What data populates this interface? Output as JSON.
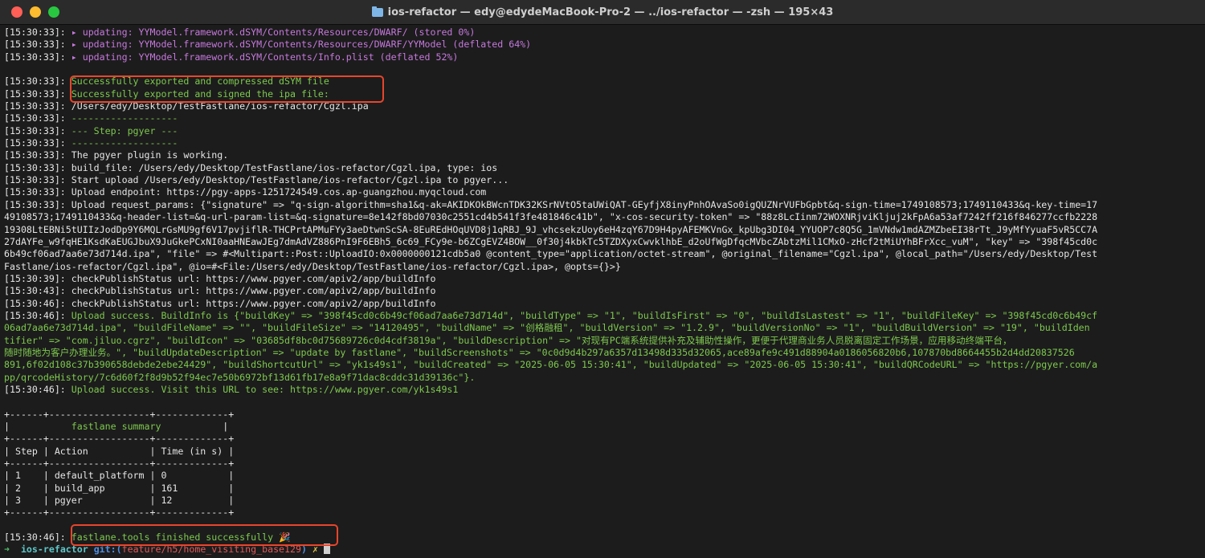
{
  "window": {
    "title": "ios-refactor — edy@edydeMacBook-Pro-2 — ../ios-refactor — -zsh — 195×43"
  },
  "lines": [
    {
      "p": "[15:30:33]: ",
      "c": "magenta",
      "t": "▸ updating: YYModel.framework.dSYM/Contents/Resources/DWARF/ (stored 0%)"
    },
    {
      "p": "[15:30:33]: ",
      "c": "magenta",
      "t": "▸ updating: YYModel.framework.dSYM/Contents/Resources/DWARF/YYModel (deflated 64%)"
    },
    {
      "p": "[15:30:33]: ",
      "c": "magenta",
      "t": "▸ updating: YYModel.framework.dSYM/Contents/Info.plist (deflated 52%)"
    },
    {
      "p": "",
      "c": "white",
      "t": ""
    },
    {
      "p": "[15:30:33]: ",
      "c": "green",
      "t": "Successfully exported and compressed dSYM file"
    },
    {
      "p": "[15:30:33]: ",
      "c": "green",
      "t": "Successfully exported and signed the ipa file:"
    },
    {
      "p": "[15:30:33]: ",
      "c": "white",
      "t": "/Users/edy/Desktop/TestFastlane/ios-refactor/Cgzl.ipa"
    },
    {
      "p": "[15:30:33]: ",
      "c": "green",
      "t": "-------------------"
    },
    {
      "p": "[15:30:33]: ",
      "c": "green",
      "t": "--- Step: pgyer ---"
    },
    {
      "p": "[15:30:33]: ",
      "c": "green",
      "t": "-------------------"
    },
    {
      "p": "[15:30:33]: ",
      "c": "white",
      "t": "The pgyer plugin is working."
    },
    {
      "p": "[15:30:33]: ",
      "c": "white",
      "t": "build_file: /Users/edy/Desktop/TestFastlane/ios-refactor/Cgzl.ipa, type: ios"
    },
    {
      "p": "[15:30:33]: ",
      "c": "white",
      "t": "Start upload /Users/edy/Desktop/TestFastlane/ios-refactor/Cgzl.ipa to pgyer..."
    },
    {
      "p": "[15:30:33]: ",
      "c": "white",
      "t": "Upload endpoint: https://pgy-apps-1251724549.cos.ap-guangzhou.myqcloud.com"
    },
    {
      "p": "[15:30:33]: ",
      "c": "white",
      "t": "Upload request_params: {\"signature\" => \"q-sign-algorithm=sha1&q-ak=AKIDKOkBWcnTDK32KSrNVtO5taUWiQAT-GEyfjX8inyPnhOAvaSo0igQUZNrVUFbGpbt&q-sign-time=1749108573;1749110433&q-key-time=17"
    },
    {
      "p": "",
      "c": "white",
      "t": "49108573;1749110433&q-header-list=&q-url-param-list=&q-signature=8e142f8bd07030c2551cd4b541f3fe481846c41b\", \"x-cos-security-token\" => \"88z8LcIinm72WOXNRjviKljuj2kFpA6a53af7242ff216f846277ccfb2228"
    },
    {
      "p": "",
      "c": "white",
      "t": "19308LtEBNi5tUIIzJodDp9Y6MQLrGsMU9gf6V17pvjiflR-THCPrtAPMuFYy3aeDtwnScSA-8EuREdHOqUVD8j1qRBJ_9J_vhcsekzUoy6eH4zqY67D9H4pyAFEMKVnGx_kpUbg3DI04_YYUOP7c8Q5G_1mVNdw1mdAZMZbeEI38rTt_J9yMfYyuaF5vR5CC7A"
    },
    {
      "p": "",
      "c": "white",
      "t": "27dAYFe_w9fqHE1KsdKaEUGJbuX9JuGkePCxNI0aaHNEawJEg7dmAdVZ886PnI9F6EBh5_6c69_FCy9e-b6ZCgEVZ4BOW__0f30j4kbkTc5TZDXyxCwvklhbE_d2oUfWgDfqcMVbcZAbtzMil1CMxO-zHcf2tMiUYhBFrXcc_vuM\", \"key\" => \"398f45cd0c"
    },
    {
      "p": "",
      "c": "white",
      "t": "6b49cf06ad7aa6e73d714d.ipa\", \"file\" => #<Multipart::Post::UploadIO:0x0000000121cdb5a0 @content_type=\"application/octet-stream\", @original_filename=\"Cgzl.ipa\", @local_path=\"/Users/edy/Desktop/Test"
    },
    {
      "p": "",
      "c": "white",
      "t": "Fastlane/ios-refactor/Cgzl.ipa\", @io=#<File:/Users/edy/Desktop/TestFastlane/ios-refactor/Cgzl.ipa>, @opts={}>}"
    },
    {
      "p": "[15:30:39]: ",
      "c": "white",
      "t": "checkPublishStatus url: https://www.pgyer.com/apiv2/app/buildInfo"
    },
    {
      "p": "[15:30:43]: ",
      "c": "white",
      "t": "checkPublishStatus url: https://www.pgyer.com/apiv2/app/buildInfo"
    },
    {
      "p": "[15:30:46]: ",
      "c": "white",
      "t": "checkPublishStatus url: https://www.pgyer.com/apiv2/app/buildInfo"
    },
    {
      "p": "[15:30:46]: ",
      "c": "green",
      "t": "Upload success. BuildInfo is {\"buildKey\" => \"398f45cd0c6b49cf06ad7aa6e73d714d\", \"buildType\" => \"1\", \"buildIsFirst\" => \"0\", \"buildIsLastest\" => \"1\", \"buildFileKey\" => \"398f45cd0c6b49cf"
    },
    {
      "p": "",
      "c": "green",
      "t": "06ad7aa6e73d714d.ipa\", \"buildFileName\" => \"\", \"buildFileSize\" => \"14120495\", \"buildName\" => \"创格融租\", \"buildVersion\" => \"1.2.9\", \"buildVersionNo\" => \"1\", \"buildBuildVersion\" => \"19\", \"buildIden"
    },
    {
      "p": "",
      "c": "green",
      "t": "tifier\" => \"com.jiluo.cgrz\", \"buildIcon\" => \"03685df8bc0d75689726c0d4cdf3819a\", \"buildDescription\" => \"对现有PC端系统提供补充及辅助性操作，更便于代理商业务人员脱离固定工作场景，应用移动终端平台，"
    },
    {
      "p": "",
      "c": "green",
      "t": "随时随地为客户办理业务。\", \"buildUpdateDescription\" => \"update by fastlane\", \"buildScreenshots\" => \"0c0d9d4b297a6357d13498d335d32065,ace89afe9c491d88904a0186056820b6,107870bd8664455b2d4dd20837526"
    },
    {
      "p": "",
      "c": "green",
      "t": "891,6f02d108c37b390658debde2ebe24429\", \"buildShortcutUrl\" => \"yk1s49s1\", \"buildCreated\" => \"2025-06-05 15:30:41\", \"buildUpdated\" => \"2025-06-05 15:30:41\", \"buildQRCodeURL\" => \"https://pgyer.com/a"
    },
    {
      "p": "",
      "c": "green",
      "t": "pp/qrcodeHistory/7c6d60f2f8d9b52f94ec7e50b6972bf13d61fb17e8a9f71dac8cddc31d39136c\"}."
    },
    {
      "p": "[15:30:46]: ",
      "c": "green",
      "t": "Upload success. Visit this URL to see: https://www.pgyer.com/yk1s49s1"
    },
    {
      "p": "",
      "c": "white",
      "t": ""
    },
    {
      "p": "",
      "c": "white",
      "t": "+------+------------------+-------------+"
    },
    {
      "p": "",
      "c": "white",
      "t": "|",
      "c2": "green",
      "t2": "           fastlane summary           ",
      "t3": "|"
    },
    {
      "p": "",
      "c": "white",
      "t": "+------+------------------+-------------+"
    },
    {
      "p": "",
      "c": "white",
      "t": "| Step | Action           | Time (in s) |"
    },
    {
      "p": "",
      "c": "white",
      "t": "+------+------------------+-------------+"
    },
    {
      "p": "",
      "c": "white",
      "t": "| 1    | default_platform | 0           |"
    },
    {
      "p": "",
      "c": "white",
      "t": "| 2    | build_app        | 161         |"
    },
    {
      "p": "",
      "c": "white",
      "t": "| 3    | pgyer            | 12          |"
    },
    {
      "p": "",
      "c": "white",
      "t": "+------+------------------+-------------+"
    },
    {
      "p": "",
      "c": "white",
      "t": ""
    },
    {
      "p": "[15:30:46]: ",
      "c": "green",
      "t": "fastlane.tools finished successfully 🎉"
    }
  ],
  "prompt": {
    "arrow": "➜",
    "dir": "ios-refactor",
    "git": "git:(",
    "branch": "feature/h5/home_visiting_base129",
    "git_close": ")",
    "x": "✗"
  },
  "colors": {
    "highlight": "#e8452c",
    "magenta": "#c678dd",
    "green": "#7ec94e"
  }
}
